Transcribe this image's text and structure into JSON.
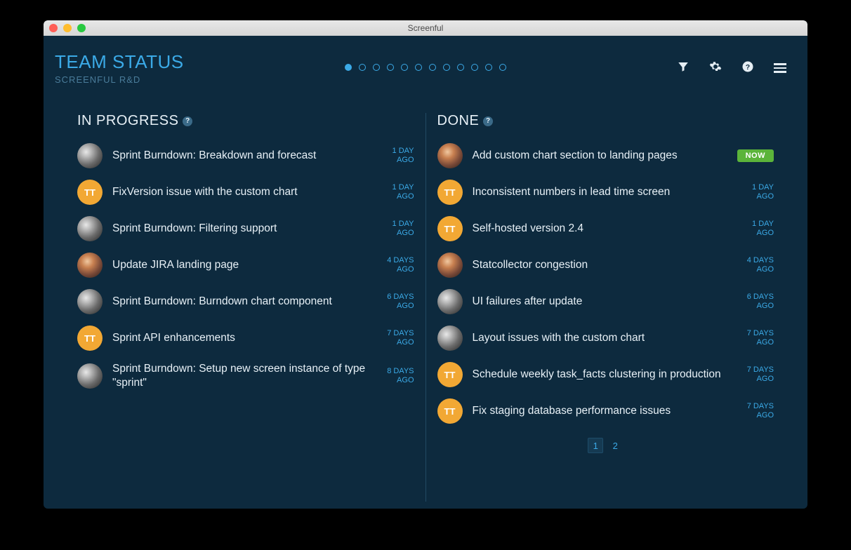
{
  "window": {
    "title": "Screenful"
  },
  "header": {
    "title": "TEAM STATUS",
    "subtitle": "SCREENFUL R&D",
    "carousel_count": 12,
    "carousel_active": 0
  },
  "columns": {
    "in_progress": {
      "label": "IN PROGRESS",
      "help": "?",
      "tasks": [
        {
          "avatar_type": "photo-gray",
          "avatar_text": "",
          "title": "Sprint Burndown: Breakdown and forecast",
          "time": "1 DAY\nAGO"
        },
        {
          "avatar_type": "initials",
          "avatar_text": "TT",
          "title": "FixVersion issue with the custom chart",
          "time": "1 DAY\nAGO"
        },
        {
          "avatar_type": "photo-gray",
          "avatar_text": "",
          "title": "Sprint Burndown: Filtering support",
          "time": "1 DAY\nAGO"
        },
        {
          "avatar_type": "photo-warm",
          "avatar_text": "",
          "title": "Update JIRA landing page",
          "time": "4 DAYS\nAGO"
        },
        {
          "avatar_type": "photo-gray",
          "avatar_text": "",
          "title": "Sprint Burndown: Burndown chart component",
          "time": "6 DAYS\nAGO"
        },
        {
          "avatar_type": "initials",
          "avatar_text": "TT",
          "title": "Sprint API enhancements",
          "time": "7 DAYS\nAGO"
        },
        {
          "avatar_type": "photo-gray",
          "avatar_text": "",
          "title": "Sprint Burndown: Setup new screen instance of type \"sprint\"",
          "time": "8 DAYS\nAGO"
        }
      ]
    },
    "done": {
      "label": "DONE",
      "help": "?",
      "tasks": [
        {
          "avatar_type": "photo-warm",
          "avatar_text": "",
          "title": "Add custom chart section to landing pages",
          "time": "NOW",
          "badge": true
        },
        {
          "avatar_type": "initials",
          "avatar_text": "TT",
          "title": "Inconsistent numbers in lead time screen",
          "time": "1 DAY\nAGO"
        },
        {
          "avatar_type": "initials",
          "avatar_text": "TT",
          "title": "Self-hosted version 2.4",
          "time": "1 DAY\nAGO"
        },
        {
          "avatar_type": "photo-warm",
          "avatar_text": "",
          "title": "Statcollector congestion",
          "time": "4 DAYS\nAGO"
        },
        {
          "avatar_type": "photo-gray",
          "avatar_text": "",
          "title": "UI failures after update",
          "time": "6 DAYS\nAGO"
        },
        {
          "avatar_type": "photo-gray",
          "avatar_text": "",
          "title": "Layout issues with the custom chart",
          "time": "7 DAYS\nAGO"
        },
        {
          "avatar_type": "initials",
          "avatar_text": "TT",
          "title": "Schedule weekly task_facts clustering in production",
          "time": "7 DAYS\nAGO"
        },
        {
          "avatar_type": "initials",
          "avatar_text": "TT",
          "title": "Fix staging database performance issues",
          "time": "7 DAYS\nAGO"
        }
      ],
      "pagination": {
        "pages": [
          "1",
          "2"
        ],
        "active": 0
      }
    }
  }
}
